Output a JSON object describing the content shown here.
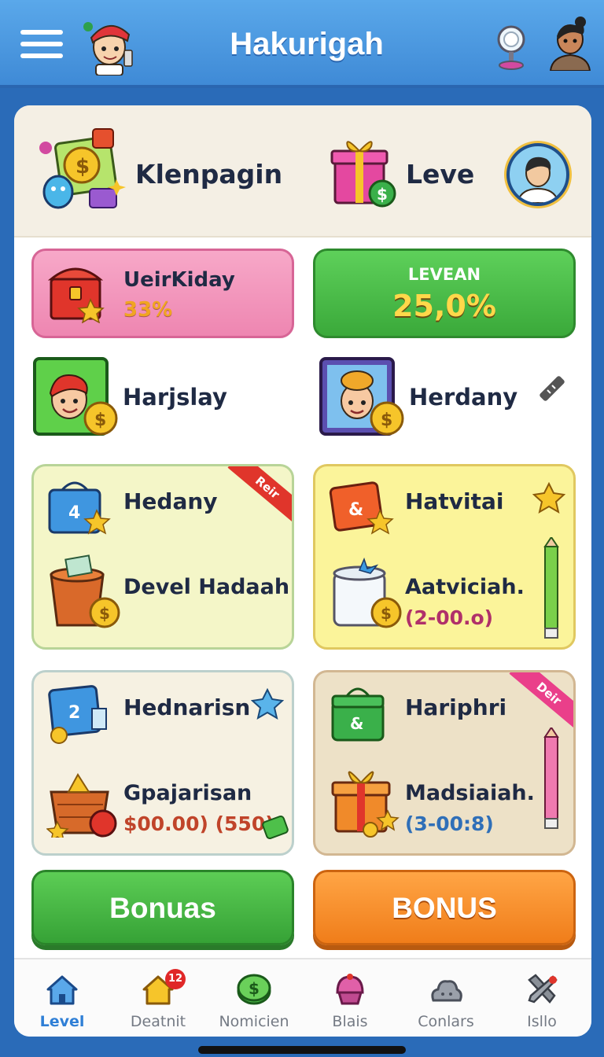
{
  "header": {
    "title": "Hakurigah",
    "menu_icon": "hamburger-menu-icon",
    "mascot_icon": "mascot-avatar-icon",
    "lamp_icon": "lamp-icon",
    "profile_icon": "user-avatar-icon"
  },
  "summary": {
    "left_label": "Klenpagin",
    "right_label": "Leve"
  },
  "stats": {
    "left": {
      "title": "UeirKiday",
      "value": "33%"
    },
    "right": {
      "title": "LEVEAN",
      "value": "25,0%"
    }
  },
  "players": [
    {
      "name": "Harjslay"
    },
    {
      "name": "Herdany"
    }
  ],
  "cards": [
    {
      "title": "Hedany",
      "subtitle": "Devel Hadaah",
      "value": "",
      "ribbon": "Reir",
      "ribbon_color": "#e0352b"
    },
    {
      "title": "Hatvitai",
      "subtitle": "Aatviciah.",
      "value": "(2-00.o)",
      "value_color": "#b0306a"
    },
    {
      "title": "Hednarisn",
      "subtitle": "Gpajarisan",
      "value": "$00.00) (550)",
      "value_color": "#c0442a"
    },
    {
      "title": "Hariphri",
      "subtitle": "Madsiaiah.",
      "value": "(3-00:8)",
      "value_color": "#2f6fb8",
      "ribbon": "Deir",
      "ribbon_color": "#ea3f8a"
    }
  ],
  "buttons": {
    "left": "Bonuas",
    "right": "BONUS"
  },
  "nav": [
    {
      "label": "Level",
      "icon": "home-icon",
      "active": true
    },
    {
      "label": "Deatnit",
      "icon": "house-badge-icon",
      "badge": "12"
    },
    {
      "label": "Nomicien",
      "icon": "coin-icon"
    },
    {
      "label": "Blais",
      "icon": "cupcake-icon"
    },
    {
      "label": "Conlars",
      "icon": "cloud-icon"
    },
    {
      "label": "Isllo",
      "icon": "tools-icon"
    }
  ],
  "colors": {
    "header": "#4a98e0",
    "panel": "#ffffff",
    "accent_green": "#3aa93a",
    "accent_orange": "#f07d1a",
    "accent_pink": "#ee86b1"
  }
}
